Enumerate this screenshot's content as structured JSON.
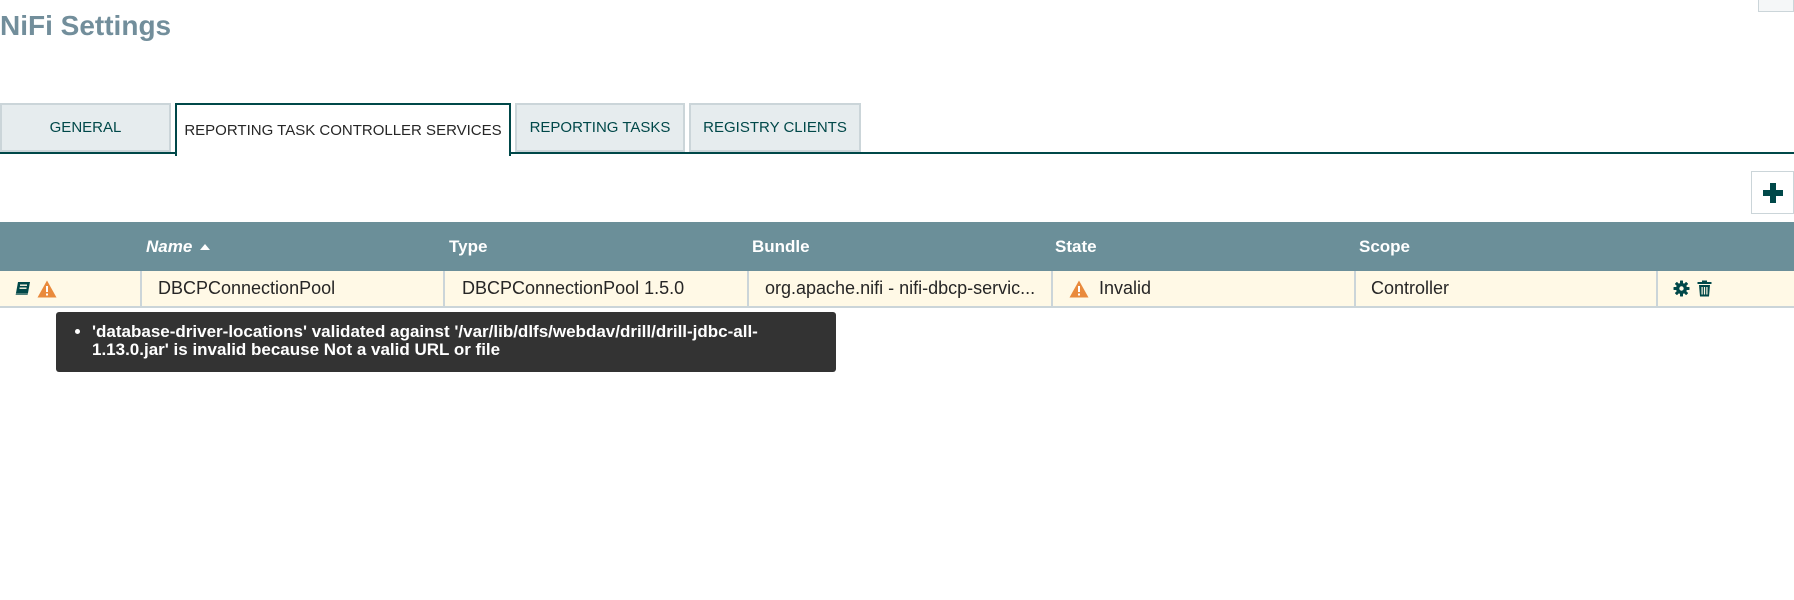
{
  "page": {
    "title": "NiFi Settings"
  },
  "tabs": [
    {
      "label": "GENERAL",
      "active": false
    },
    {
      "label": "REPORTING TASK CONTROLLER SERVICES",
      "active": true
    },
    {
      "label": "REPORTING TASKS",
      "active": false
    },
    {
      "label": "REGISTRY CLIENTS",
      "active": false
    }
  ],
  "toolbar": {
    "add_icon": "plus-icon"
  },
  "table": {
    "columns": [
      "Name",
      "Type",
      "Bundle",
      "State",
      "Scope"
    ],
    "sort": {
      "column": "Name",
      "direction": "ascending"
    },
    "rows": [
      {
        "icons": [
          "book-icon",
          "warning-icon"
        ],
        "name": "DBCPConnectionPool",
        "type": "DBCPConnectionPool 1.5.0",
        "bundle": "org.apache.nifi - nifi-dbcp-servic...",
        "state_icon": "warning-icon",
        "state": "Invalid",
        "scope": "Controller",
        "actions": [
          "gear-icon",
          "trash-icon"
        ]
      }
    ]
  },
  "tooltip": {
    "items": [
      "'database-driver-locations' validated against '/var/lib/dlfs/webdav/drill/drill-jdbc-all-1.13.0.jar' is invalid because Not a valid URL or file"
    ]
  },
  "colors": {
    "title": "#728e9b",
    "accent": "#004849",
    "header_bg": "#6b8f99",
    "row_bg": "#fff9e6",
    "warning": "#e98a3c",
    "tooltip_bg": "#333333"
  }
}
